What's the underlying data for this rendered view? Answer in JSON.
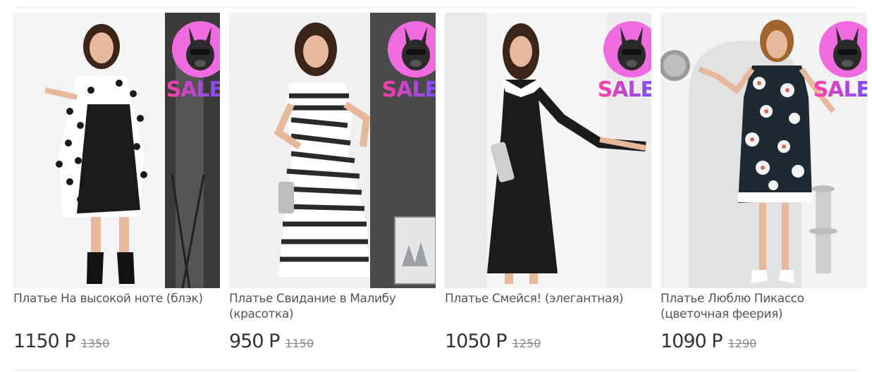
{
  "products": [
    {
      "title": "Платье На высокой ноте (блэк)",
      "price": "1150 Р",
      "old_price": "1350",
      "badge": "SALE",
      "image": "woman-polka-dot-dress-photo"
    },
    {
      "title": "Платье Свидание в Малибу (красотка)",
      "price": "950 Р",
      "old_price": "1150",
      "badge": "SALE",
      "image": "woman-striped-dress-photo"
    },
    {
      "title": "Платье Смейся! (элегантная)",
      "price": "1050 Р",
      "old_price": "1250",
      "badge": "SALE",
      "image": "woman-black-collar-dress-photo"
    },
    {
      "title": "Платье Люблю Пикассо (цветочная феерия)",
      "price": "1090 Р",
      "old_price": "1290",
      "badge": "SALE",
      "image": "woman-floral-dress-photo"
    }
  ],
  "colors": {
    "badge_pink": "#f06ae0",
    "sale_gradient_start": "#ff3fa6",
    "sale_gradient_end": "#7a4cff",
    "title_text": "#555555",
    "price_text": "#333333",
    "old_price_text": "#888888"
  }
}
